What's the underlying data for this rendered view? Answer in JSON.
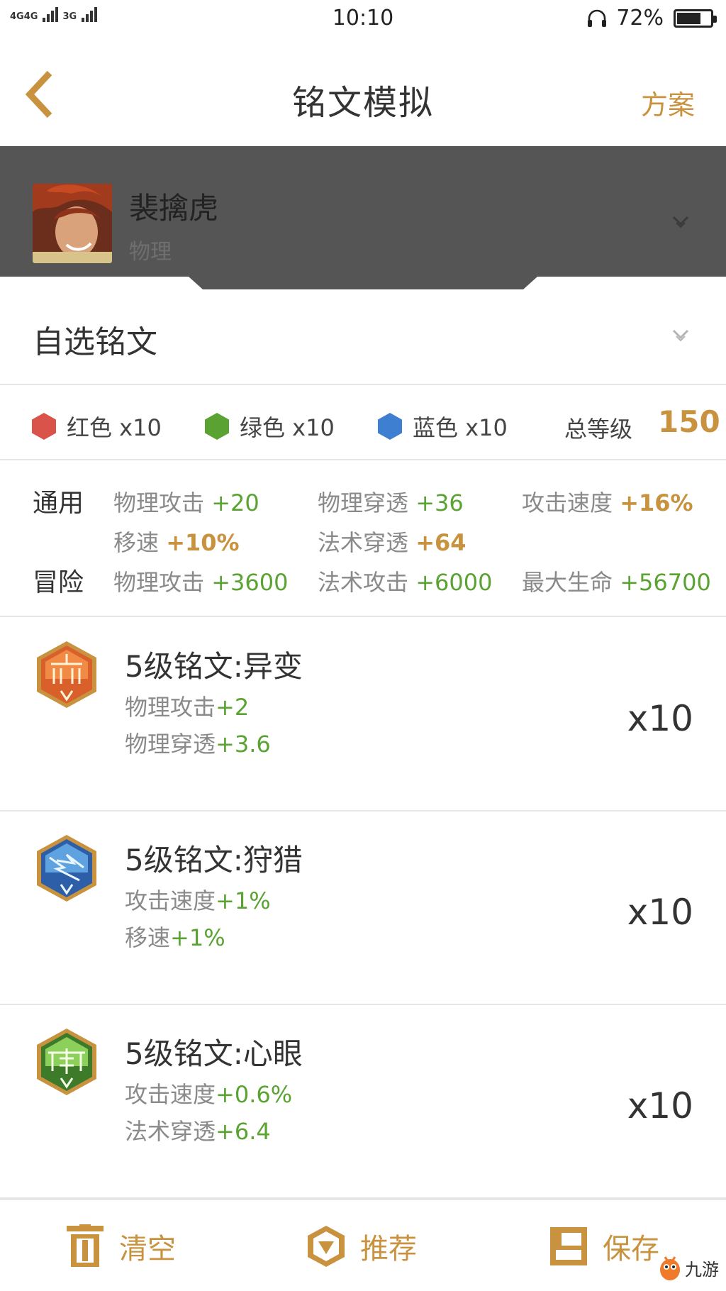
{
  "status_bar": {
    "network_1": "4G",
    "network_2": "4G",
    "network_3": "3G",
    "time": "10:10",
    "battery": "72%",
    "battery_level": 0.72
  },
  "nav": {
    "title": "铭文模拟",
    "scheme_label": "方案"
  },
  "hero": {
    "name": "裴擒虎",
    "type": "物理"
  },
  "custom": {
    "label": "自选铭文"
  },
  "colors": {
    "red": {
      "label": "红色 x10",
      "color": "#d9534a"
    },
    "green": {
      "label": "绿色 x10",
      "color": "#5aa332"
    },
    "blue": {
      "label": "蓝色 x10",
      "color": "#3f7fd1"
    },
    "total_label": "总等级",
    "total_value": "150"
  },
  "stats": {
    "general_label": "通用",
    "adventure_label": "冒险",
    "general": [
      {
        "name": "物理攻击 ",
        "value": "+20"
      },
      {
        "name": "物理穿透 ",
        "value": "+36"
      },
      {
        "name": "攻击速度 ",
        "value": "+16%"
      },
      {
        "name": "移速 ",
        "value": "+10%"
      },
      {
        "name": "法术穿透 ",
        "value": "+64"
      }
    ],
    "adventure": [
      {
        "name": "物理攻击 ",
        "value": "+3600"
      },
      {
        "name": "法术攻击 ",
        "value": "+6000"
      },
      {
        "name": "最大生命 ",
        "value": "+56700"
      }
    ]
  },
  "runes": [
    {
      "name": "5级铭文:异变",
      "stats": [
        {
          "name": "物理攻击",
          "value": "+2"
        },
        {
          "name": "物理穿透",
          "value": "+3.6"
        }
      ],
      "count": "x10",
      "color": "red"
    },
    {
      "name": "5级铭文:狩猎",
      "stats": [
        {
          "name": "攻击速度",
          "value": "+1%"
        },
        {
          "name": "移速",
          "value": "+1%"
        }
      ],
      "count": "x10",
      "color": "blue"
    },
    {
      "name": "5级铭文:心眼",
      "stats": [
        {
          "name": "攻击速度",
          "value": "+0.6%"
        },
        {
          "name": "法术穿透",
          "value": "+6.4"
        }
      ],
      "count": "x10",
      "color": "green"
    }
  ],
  "toolbar": {
    "clear_label": "清空",
    "recommend_label": "推荐",
    "save_label": "保存"
  },
  "watermark": {
    "text": "九游"
  },
  "theme": {
    "accent": "#c8923e",
    "green_value": "#5aa332",
    "hero_bg": "#555555"
  }
}
